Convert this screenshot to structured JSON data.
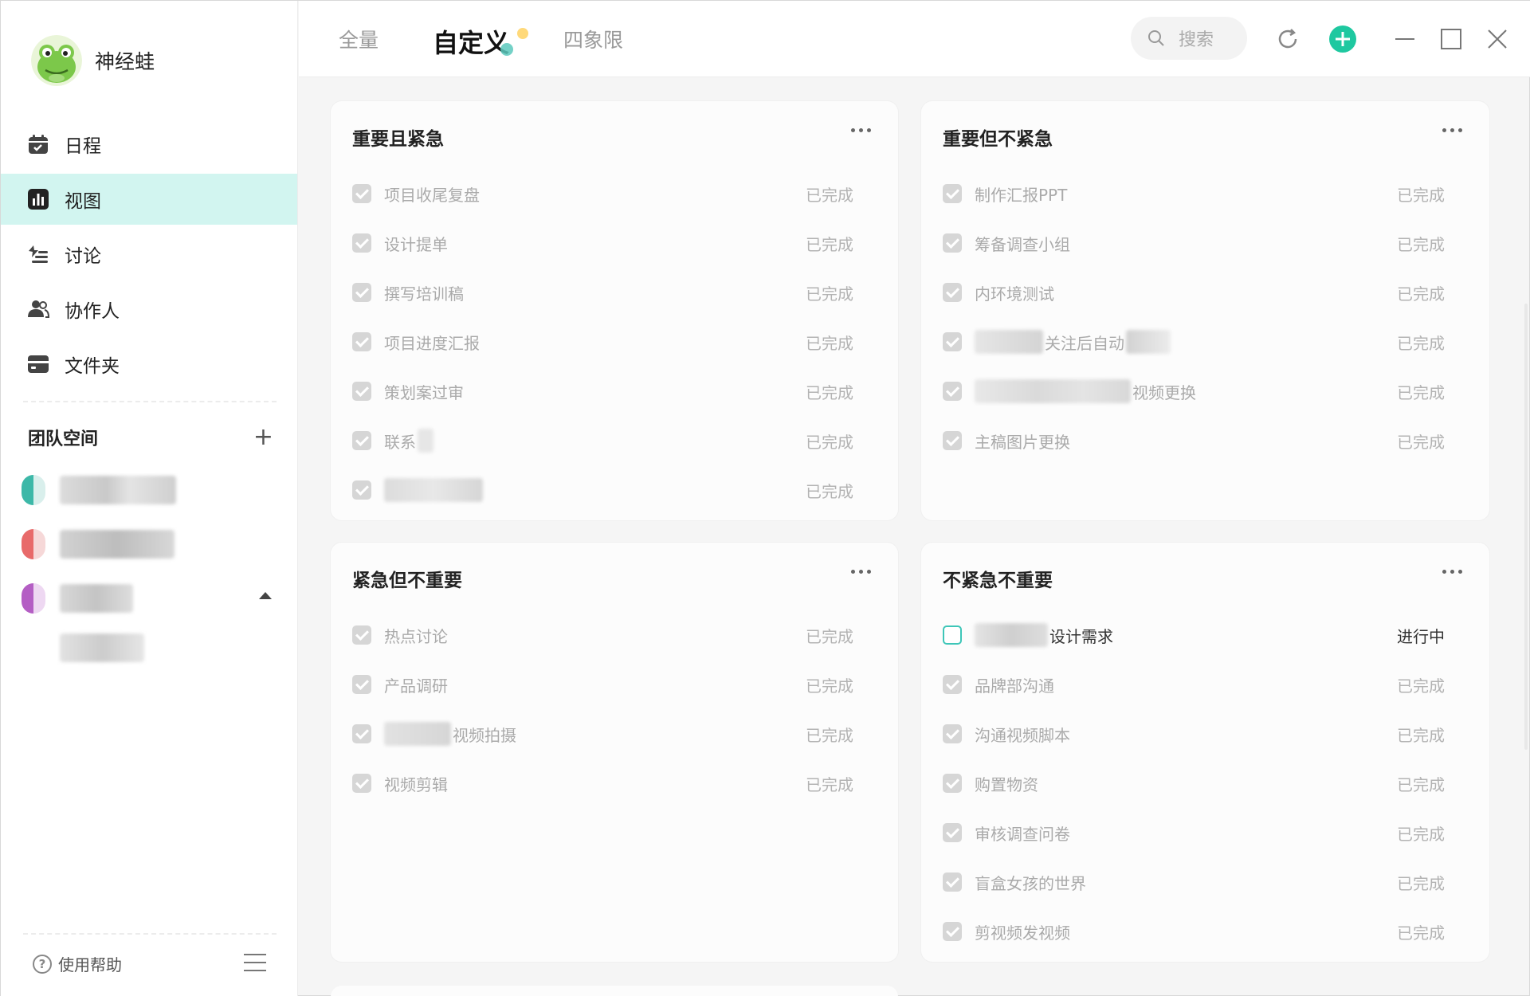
{
  "user": {
    "name": "神经蛙"
  },
  "sidebar": {
    "nav": [
      {
        "label": "日程",
        "icon": "calendar-icon"
      },
      {
        "label": "视图",
        "icon": "chart-icon",
        "active": true
      },
      {
        "label": "讨论",
        "icon": "discussion-icon"
      },
      {
        "label": "协作人",
        "icon": "people-icon"
      },
      {
        "label": "文件夹",
        "icon": "folder-icon"
      }
    ],
    "team_title": "团队空间",
    "help_label": "使用帮助"
  },
  "tabs": [
    {
      "label": "全量"
    },
    {
      "label": "自定义",
      "active": true
    },
    {
      "label": "四象限"
    }
  ],
  "search": {
    "placeholder": "搜索"
  },
  "colors": {
    "accent": "#1ec8a0",
    "active_nav": "#d2f5f0",
    "open_checkbox": "#3ec6b8"
  },
  "quadrants": [
    {
      "title": "重要且紧急",
      "tasks": [
        {
          "text": "项目收尾复盘",
          "status": "已完成"
        },
        {
          "text": "设计提单",
          "status": "已完成"
        },
        {
          "text": "撰写培训稿",
          "status": "已完成"
        },
        {
          "text": "项目进度汇报",
          "status": "已完成"
        },
        {
          "text": "策划案过审",
          "status": "已完成"
        },
        {
          "text": "联系",
          "status": "已完成"
        },
        {
          "text": "",
          "status": "已完成"
        }
      ]
    },
    {
      "title": "重要但不紧急",
      "tasks": [
        {
          "text": "制作汇报PPT",
          "status": "已完成"
        },
        {
          "text": "筹备调查小组",
          "status": "已完成"
        },
        {
          "text": "内环境测试",
          "status": "已完成"
        },
        {
          "text": "关注后自动",
          "status": "已完成"
        },
        {
          "text": "视频更换",
          "status": "已完成"
        },
        {
          "text": "主稿图片更换",
          "status": "已完成"
        }
      ]
    },
    {
      "title": "紧急但不重要",
      "tasks": [
        {
          "text": "热点讨论",
          "status": "已完成"
        },
        {
          "text": "产品调研",
          "status": "已完成"
        },
        {
          "text": "视频拍摄",
          "status": "已完成"
        },
        {
          "text": "视频剪辑",
          "status": "已完成"
        }
      ]
    },
    {
      "title": "不紧急不重要",
      "tasks": [
        {
          "text": "设计需求",
          "status": "进行中",
          "done": false
        },
        {
          "text": "品牌部沟通",
          "status": "已完成"
        },
        {
          "text": "沟通视频脚本",
          "status": "已完成"
        },
        {
          "text": "购置物资",
          "status": "已完成"
        },
        {
          "text": "审核调查问卷",
          "status": "已完成"
        },
        {
          "text": "盲盒女孩的世界",
          "status": "已完成"
        },
        {
          "text": "剪视频发视频",
          "status": "已完成"
        }
      ]
    }
  ]
}
